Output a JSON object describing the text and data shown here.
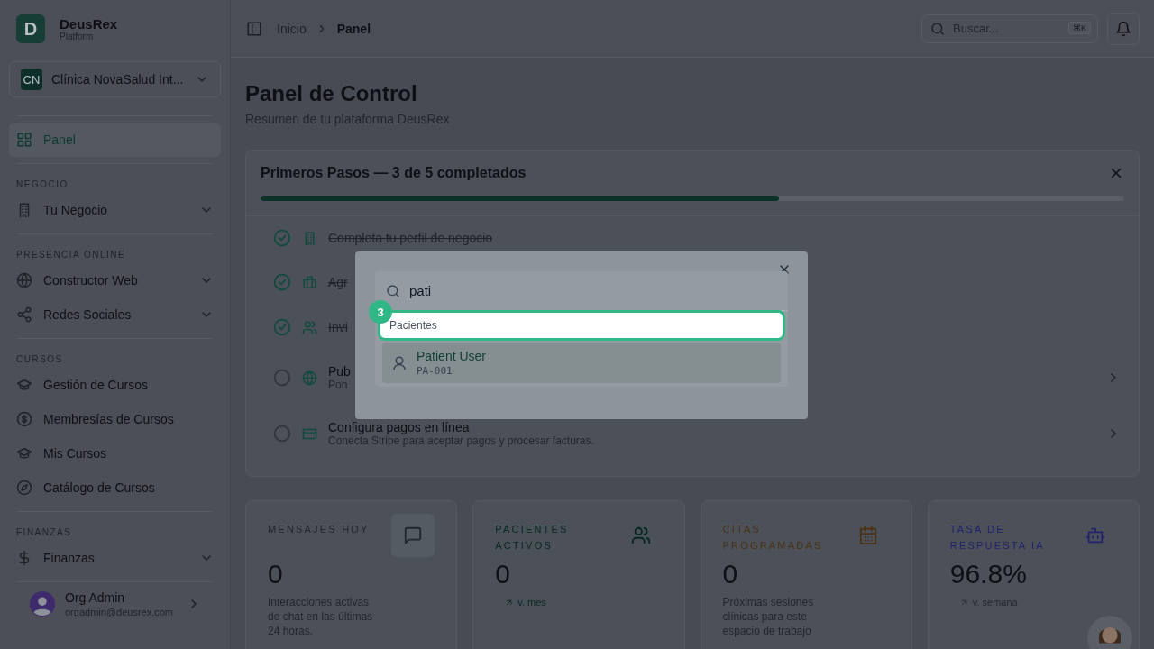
{
  "brand": {
    "logo": "D",
    "name": "DeusRex",
    "subtitle": "Platform"
  },
  "org_selector": {
    "initials": "CN",
    "name": "Clínica NovaSalud Int..."
  },
  "sidebar": {
    "sections": [
      {
        "items": [
          {
            "label": "Panel",
            "kind": "link",
            "selected": true
          }
        ]
      },
      {
        "title": "NEGOCIO",
        "items": [
          {
            "label": "Tu Negocio",
            "kind": "group",
            "selected": false
          }
        ]
      },
      {
        "title": "PRESENCIA ONLINE",
        "items": [
          {
            "label": "Constructor Web",
            "kind": "group",
            "selected": false
          },
          {
            "label": "Redes Sociales",
            "kind": "group",
            "selected": false
          }
        ]
      },
      {
        "title": "CURSOS",
        "items": [
          {
            "label": "Gestión de Cursos",
            "kind": "link",
            "selected": false
          },
          {
            "label": "Membresías de Cursos",
            "kind": "link",
            "selected": false
          },
          {
            "label": "Mis Cursos",
            "kind": "link",
            "selected": false
          },
          {
            "label": "Catálogo de Cursos",
            "kind": "link",
            "selected": false
          }
        ]
      },
      {
        "title": "FINANZAS",
        "items": [
          {
            "label": "Finanzas",
            "kind": "group",
            "selected": false
          }
        ]
      }
    ],
    "user": {
      "name": "Org Admin",
      "email": "orgadmin@deusrex.com"
    }
  },
  "breadcrumb": [
    "Inicio",
    "Panel"
  ],
  "search": {
    "placeholder": "Buscar...",
    "shortcut": "⌘K"
  },
  "page": {
    "title": "Panel de Control",
    "subtitle": "Resumen de tu plataforma DeusRex"
  },
  "onboarding": {
    "title": "Primeros Pasos — 3 de 5 completados",
    "level": 0.6,
    "steps": [
      {
        "done": true,
        "title": "Completa tu perfil de negocio"
      },
      {
        "done": true,
        "title": "Agr"
      },
      {
        "done": true,
        "title": "Invi"
      },
      {
        "done": false,
        "title": "Pub",
        "description": "Pon"
      },
      {
        "done": false,
        "title": "Configura pagos en línea",
        "description": "Conecta Stripe para aceptar pagos y procesar facturas."
      }
    ]
  },
  "stats": [
    {
      "label": "MENSAJES HOY",
      "color": "#23262d",
      "value": "0",
      "description": "Interacciones activas de chat en las últimas 24 horas."
    },
    {
      "label": "PACIENTES ACTIVOS",
      "color": "#06281f",
      "value": "0",
      "trend": "v. mes"
    },
    {
      "label": "CITAS PROGRAMADAS",
      "color": "#4a3212",
      "value": "0",
      "description": "Próximas sesiones clínicas para este espacio de trabajo"
    },
    {
      "label": "TASA DE RESPUESTA IA",
      "color": "#25206e",
      "value": "96.8%",
      "trend": "v. semana",
      "assistant": true
    }
  ],
  "command_dialog": {
    "query": "pati",
    "group": "Pacientes",
    "step_badge": "3",
    "results": [
      {
        "title": "Patient User",
        "code": "PA-001",
        "selected": true
      }
    ]
  }
}
